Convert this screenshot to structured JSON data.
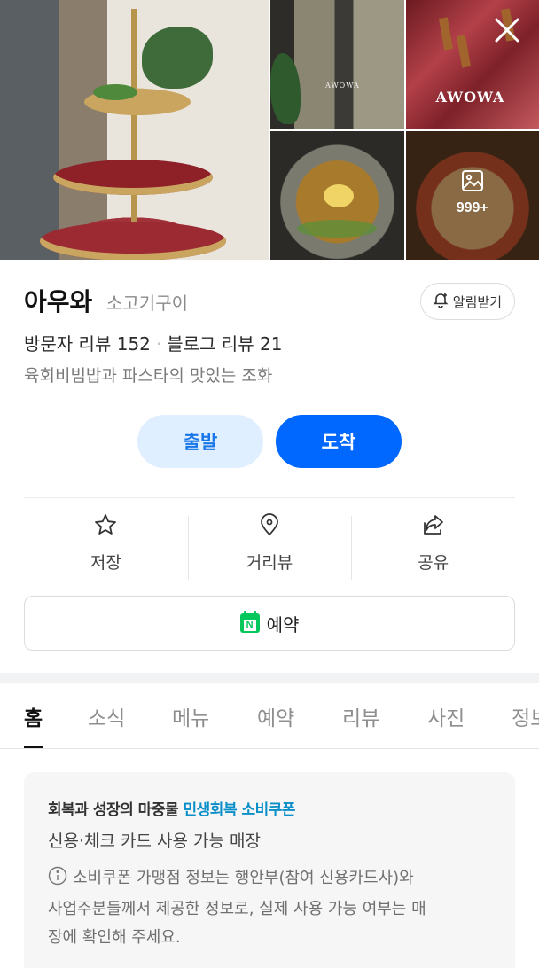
{
  "gallery": {
    "photos": [
      {
        "name": "main-photo",
        "alt": "Beef platter stand"
      },
      {
        "name": "interior-photo",
        "sign": "AWOWA"
      },
      {
        "name": "meat-photo",
        "sign": "AWOWA"
      },
      {
        "name": "noodle-photo"
      },
      {
        "name": "bibimbap-photo"
      }
    ],
    "more_count": "999+"
  },
  "place": {
    "name": "아우와",
    "category": "소고기구이",
    "alert_label": "알림받기",
    "visitor_reviews_label": "방문자 리뷰 152",
    "blog_reviews_label": "블로그 리뷰 21",
    "description": "육회비빔밥과 파스타의 맛있는 조화"
  },
  "route": {
    "depart_label": "출발",
    "arrive_label": "도착"
  },
  "actions": {
    "save_label": "저장",
    "streetview_label": "거리뷰",
    "share_label": "공유"
  },
  "reserve": {
    "label": "예약",
    "icon": "naver-booking-icon"
  },
  "tabs": [
    "홈",
    "소식",
    "메뉴",
    "예약",
    "리뷰",
    "사진",
    "정보"
  ],
  "coupon": {
    "headline_prefix": "회복과 성장의 마중물",
    "headline_highlight": "민생회복 소비쿠폰",
    "subtitle": "신용·체크 카드 사용 가능 매장",
    "notice_line1": "소비쿠폰 가맹점 정보는 행안부(참여 신용카드사)와",
    "notice_line2": "사업주분들께서 제공한 정보로, 실제 사용 가능 여부는 매",
    "notice_line3": "장에 확인해 주세요."
  },
  "colors": {
    "primary_blue": "#0068ff",
    "light_blue": "#e0efff",
    "naver_green": "#03c75a",
    "highlight": "#0b8fc8"
  }
}
